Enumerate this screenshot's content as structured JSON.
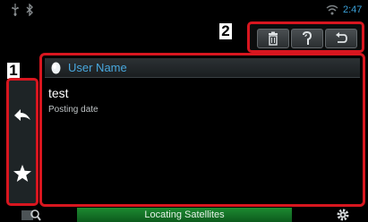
{
  "status_bar": {
    "clock": "2:47",
    "icons": [
      "usb-icon",
      "bluetooth-icon",
      "wifi-icon"
    ]
  },
  "callouts": {
    "toolbar_marker": "2",
    "sidebar_marker": "1"
  },
  "toolbar": {
    "buttons": [
      "delete-icon",
      "voice-icon",
      "back-icon"
    ]
  },
  "sidebar": {
    "buttons": [
      "reply-icon",
      "favorite-icon"
    ]
  },
  "post": {
    "user_name": "User Name",
    "text": "test",
    "date_label": "Posting date"
  },
  "bottom_bar": {
    "nav_status": "Locating Satellites",
    "icons": [
      "map-search-icon",
      "settings-icon"
    ]
  },
  "colors": {
    "highlight_border": "#d8161f",
    "accent_blue": "#49a8de",
    "status_green": "#1d8a31"
  }
}
